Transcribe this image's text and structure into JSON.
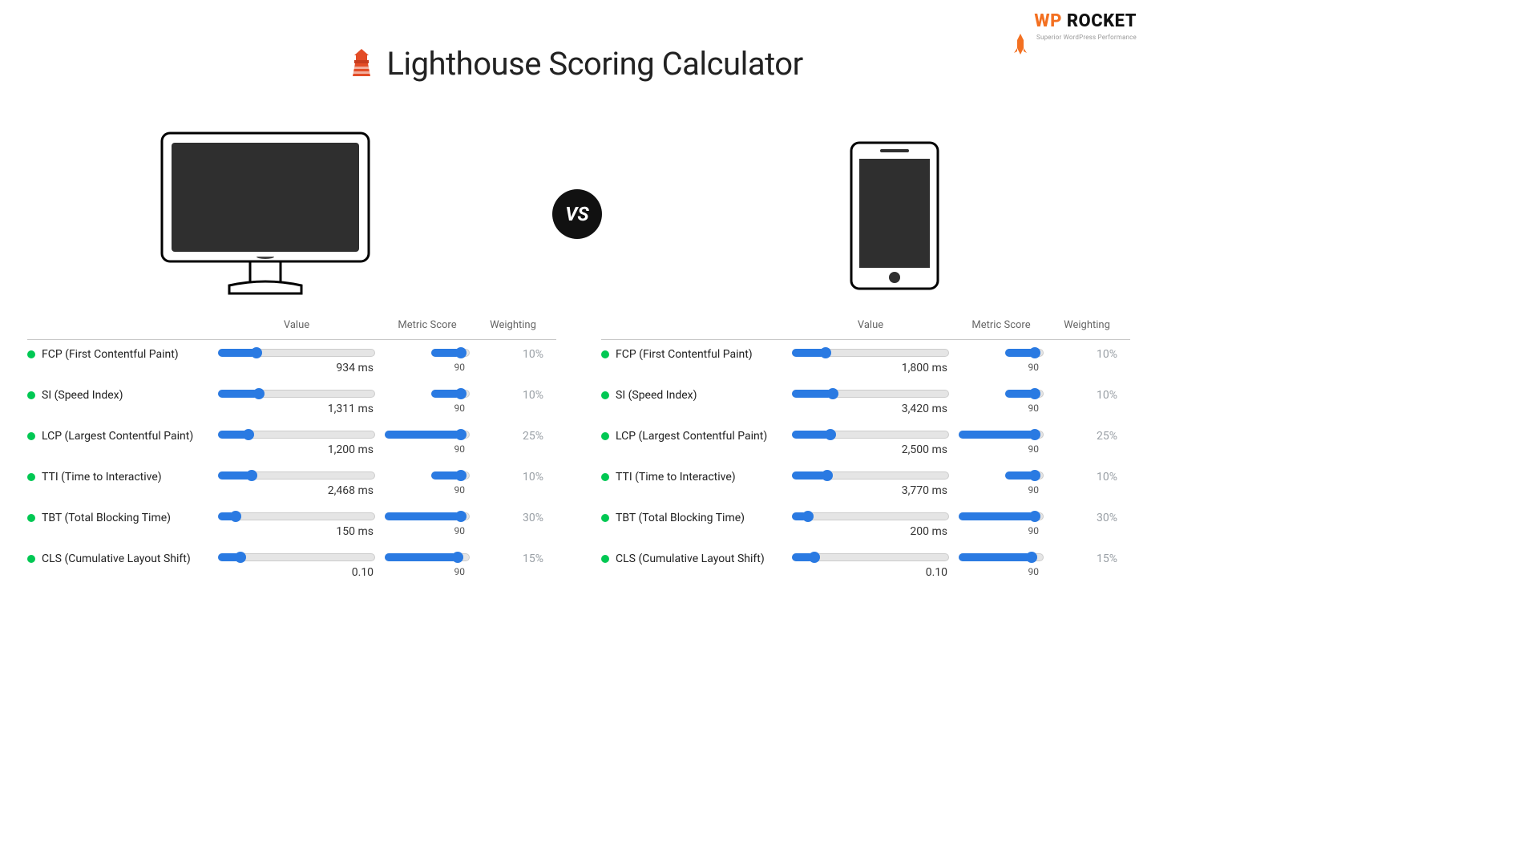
{
  "page_title": "Lighthouse Scoring Calculator",
  "brand": {
    "wp": "WP",
    "rocket": " ROCKET",
    "tagline": "Superior WordPress Performance"
  },
  "vs": "VS",
  "columns": {
    "label": "",
    "value": "Value",
    "score": "Metric Score",
    "weight": "Weighting"
  },
  "metrics": {
    "fcp": "FCP (First Contentful Paint)",
    "si": "SI (Speed Index)",
    "lcp": "LCP (Largest Contentful Paint)",
    "tti": "TTI (Time to Interactive)",
    "tbt": "TBT (Total Blocking Time)",
    "cls": "CLS (Cumulative Layout Shift)"
  },
  "desktop": {
    "rows": [
      {
        "key": "fcp",
        "value": "934 ms",
        "value_pct": 24,
        "score": "90",
        "score_pct": 78,
        "score_style": "small",
        "weight": "10%"
      },
      {
        "key": "si",
        "value": "1,311 ms",
        "value_pct": 26,
        "score": "90",
        "score_pct": 78,
        "score_style": "small",
        "weight": "10%"
      },
      {
        "key": "lcp",
        "value": "1,200 ms",
        "value_pct": 19,
        "score": "90",
        "score_pct": 90,
        "score_style": "large",
        "weight": "25%"
      },
      {
        "key": "tti",
        "value": "2,468 ms",
        "value_pct": 21,
        "score": "90",
        "score_pct": 78,
        "score_style": "small",
        "weight": "10%"
      },
      {
        "key": "tbt",
        "value": "150 ms",
        "value_pct": 11,
        "score": "90",
        "score_pct": 90,
        "score_style": "large",
        "weight": "30%"
      },
      {
        "key": "cls",
        "value": "0.10",
        "value_pct": 14,
        "score": "90",
        "score_pct": 87,
        "score_style": "large",
        "weight": "15%"
      }
    ]
  },
  "mobile": {
    "rows": [
      {
        "key": "fcp",
        "value": "1,800 ms",
        "value_pct": 21,
        "score": "90",
        "score_pct": 78,
        "score_style": "small",
        "weight": "10%"
      },
      {
        "key": "si",
        "value": "3,420 ms",
        "value_pct": 26,
        "score": "90",
        "score_pct": 78,
        "score_style": "small",
        "weight": "10%"
      },
      {
        "key": "lcp",
        "value": "2,500 ms",
        "value_pct": 24,
        "score": "90",
        "score_pct": 90,
        "score_style": "large",
        "weight": "25%"
      },
      {
        "key": "tti",
        "value": "3,770 ms",
        "value_pct": 22,
        "score": "90",
        "score_pct": 78,
        "score_style": "small",
        "weight": "10%"
      },
      {
        "key": "tbt",
        "value": "200 ms",
        "value_pct": 10,
        "score": "90",
        "score_pct": 90,
        "score_style": "large",
        "weight": "30%"
      },
      {
        "key": "cls",
        "value": "0.10",
        "value_pct": 14,
        "score": "90",
        "score_pct": 87,
        "score_style": "large",
        "weight": "15%"
      }
    ]
  }
}
